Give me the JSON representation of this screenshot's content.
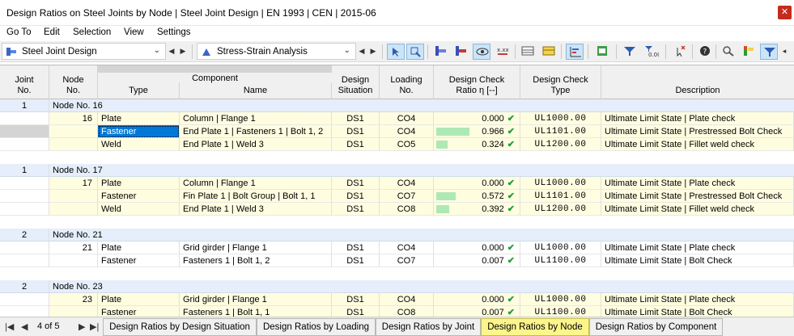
{
  "window": {
    "title": "Design Ratios on Steel Joints by Node | Steel Joint Design | EN 1993 | CEN | 2015-06",
    "close": "✕"
  },
  "menu": [
    "Go To",
    "Edit",
    "Selection",
    "View",
    "Settings"
  ],
  "toolbar": {
    "module_select": "Steel Joint Design",
    "analysis_select": "Stress-Strain Analysis"
  },
  "columns": {
    "joint_no": [
      "Joint",
      "No."
    ],
    "node_no": [
      "Node",
      "No."
    ],
    "component": "Component",
    "type": "Type",
    "name": "Name",
    "design_situation": [
      "Design",
      "Situation"
    ],
    "loading_no": [
      "Loading",
      "No."
    ],
    "design_check_ratio": [
      "Design Check",
      "Ratio η [--]"
    ],
    "design_check_type": [
      "Design Check",
      "Type"
    ],
    "description": "Description"
  },
  "groups": [
    {
      "joint": "1",
      "node_label": "Node No. 16",
      "rows": [
        {
          "node": "16",
          "type": "Plate",
          "name": "Column | Flange 1",
          "ds": "DS1",
          "lo": "CO4",
          "ratio": "0.000",
          "ratio_value": 0.0,
          "check": "UL1000.00",
          "desc": "Ultimate Limit State | Plate check",
          "bg": "#fffde0"
        },
        {
          "node": "",
          "type": "Fastener",
          "name": "End Plate 1 | Fasteners 1 | Bolt 1, 2",
          "ds": "DS1",
          "lo": "CO4",
          "ratio": "0.966",
          "ratio_value": 0.966,
          "check": "UL1101.00",
          "desc": "Ultimate Limit State | Prestressed Bolt Check",
          "bg": "#fffde0",
          "selected": true
        },
        {
          "node": "",
          "type": "Weld",
          "name": "End Plate 1 | Weld 3",
          "ds": "DS1",
          "lo": "CO5",
          "ratio": "0.324",
          "ratio_value": 0.324,
          "check": "UL1200.00",
          "desc": "Ultimate Limit State | Fillet weld check",
          "bg": "#fffde0"
        }
      ]
    },
    {
      "joint": "1",
      "node_label": "Node No. 17",
      "rows": [
        {
          "node": "17",
          "type": "Plate",
          "name": "Column | Flange 1",
          "ds": "DS1",
          "lo": "CO4",
          "ratio": "0.000",
          "ratio_value": 0.0,
          "check": "UL1000.00",
          "desc": "Ultimate Limit State | Plate check",
          "bg": "#fffde0"
        },
        {
          "node": "",
          "type": "Fastener",
          "name": "Fin Plate 1 | Bolt Group | Bolt 1, 1",
          "ds": "DS1",
          "lo": "CO7",
          "ratio": "0.572",
          "ratio_value": 0.572,
          "check": "UL1101.00",
          "desc": "Ultimate Limit State | Prestressed Bolt Check",
          "bg": "#fffde0"
        },
        {
          "node": "",
          "type": "Weld",
          "name": "End Plate 1 | Weld 3",
          "ds": "DS1",
          "lo": "CO8",
          "ratio": "0.392",
          "ratio_value": 0.392,
          "check": "UL1200.00",
          "desc": "Ultimate Limit State | Fillet weld check",
          "bg": "#fffde0"
        }
      ]
    },
    {
      "joint": "2",
      "node_label": "Node No. 21",
      "rows": [
        {
          "node": "21",
          "type": "Plate",
          "name": "Grid girder | Flange 1",
          "ds": "DS1",
          "lo": "CO4",
          "ratio": "0.000",
          "ratio_value": 0.0,
          "check": "UL1000.00",
          "desc": "Ultimate Limit State | Plate check",
          "bg": "#ffffff"
        },
        {
          "node": "",
          "type": "Fastener",
          "name": "Fasteners 1 | Bolt 1, 2",
          "ds": "DS1",
          "lo": "CO7",
          "ratio": "0.007",
          "ratio_value": 0.007,
          "check": "UL1100.00",
          "desc": "Ultimate Limit State | Bolt Check",
          "bg": "#ffffff"
        }
      ]
    },
    {
      "joint": "2",
      "node_label": "Node No. 23",
      "rows": [
        {
          "node": "23",
          "type": "Plate",
          "name": "Grid girder | Flange 1",
          "ds": "DS1",
          "lo": "CO4",
          "ratio": "0.000",
          "ratio_value": 0.0,
          "check": "UL1000.00",
          "desc": "Ultimate Limit State | Plate check",
          "bg": "#fffde0"
        },
        {
          "node": "",
          "type": "Fastener",
          "name": "Fasteners 1 | Bolt 1, 1",
          "ds": "DS1",
          "lo": "CO8",
          "ratio": "0.007",
          "ratio_value": 0.007,
          "check": "UL1100.00",
          "desc": "Ultimate Limit State | Bolt Check",
          "bg": "#fffde0"
        }
      ]
    }
  ],
  "status": {
    "page": "4 of 5",
    "first": "|◀",
    "prev": "◀",
    "next": "▶",
    "last": "▶|"
  },
  "tabs": [
    {
      "label": "Design Ratios by Design Situation",
      "active": false
    },
    {
      "label": "Design Ratios by Loading",
      "active": false
    },
    {
      "label": "Design Ratios by Joint",
      "active": false
    },
    {
      "label": "Design Ratios by Node",
      "active": true
    },
    {
      "label": "Design Ratios by Component",
      "active": false
    }
  ],
  "colors": {
    "accent_tab": "#fcf58c",
    "group_row": "#e5eefa",
    "data_row": "#fffde0",
    "selected_cell": "#0078d7",
    "ratio_bar": "#aee8b5",
    "check_ok": "#1e9e3a"
  },
  "icons": {
    "module": "steel-joint-icon",
    "analysis": "stress-strain-icon",
    "check": "checkmark-icon"
  }
}
